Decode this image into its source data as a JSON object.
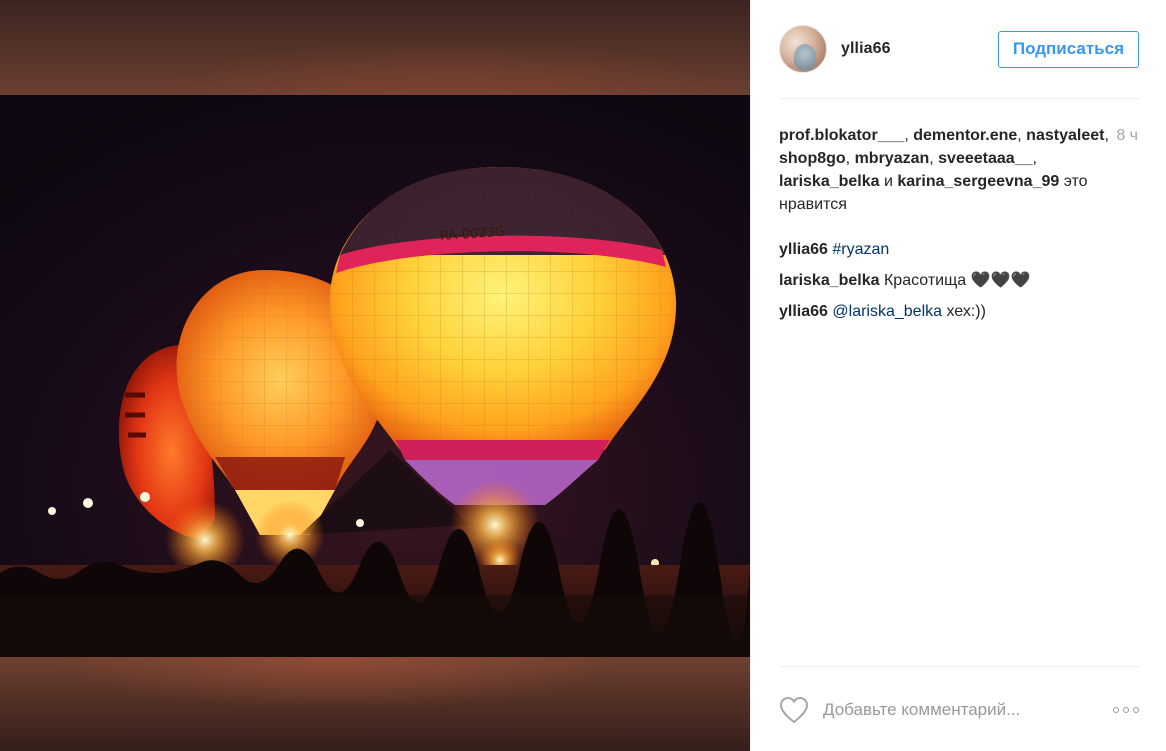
{
  "post": {
    "username": "yllia66",
    "follow_label": "Подписаться",
    "time": "8 ч",
    "likes": {
      "users": [
        "prof.blokator___",
        "dementor.ene",
        "nastyaleet",
        "shop8go",
        "mbryazan",
        "sveeetaaa__",
        "lariska_belka",
        "karina_sergeevna_99"
      ],
      "separator": ", ",
      "and_word": " и ",
      "suffix": " это нравится"
    },
    "comments": [
      {
        "author": "yllia66",
        "link": "#ryazan",
        "text": ""
      },
      {
        "author": "lariska_belka",
        "link": "",
        "text": "Красотища 🖤🖤🖤"
      },
      {
        "author": "yllia66",
        "link": "@lariska_belka",
        "text": " хех:))"
      }
    ],
    "comment_placeholder": "Добавьте комментарий...",
    "balloon_registration": "RA-0023G"
  },
  "icons": {
    "like": "heart-outline-icon",
    "more": "more-options-icon"
  },
  "colors": {
    "accent": "#3897f0",
    "link": "#003569",
    "muted": "#a5a7aa"
  }
}
